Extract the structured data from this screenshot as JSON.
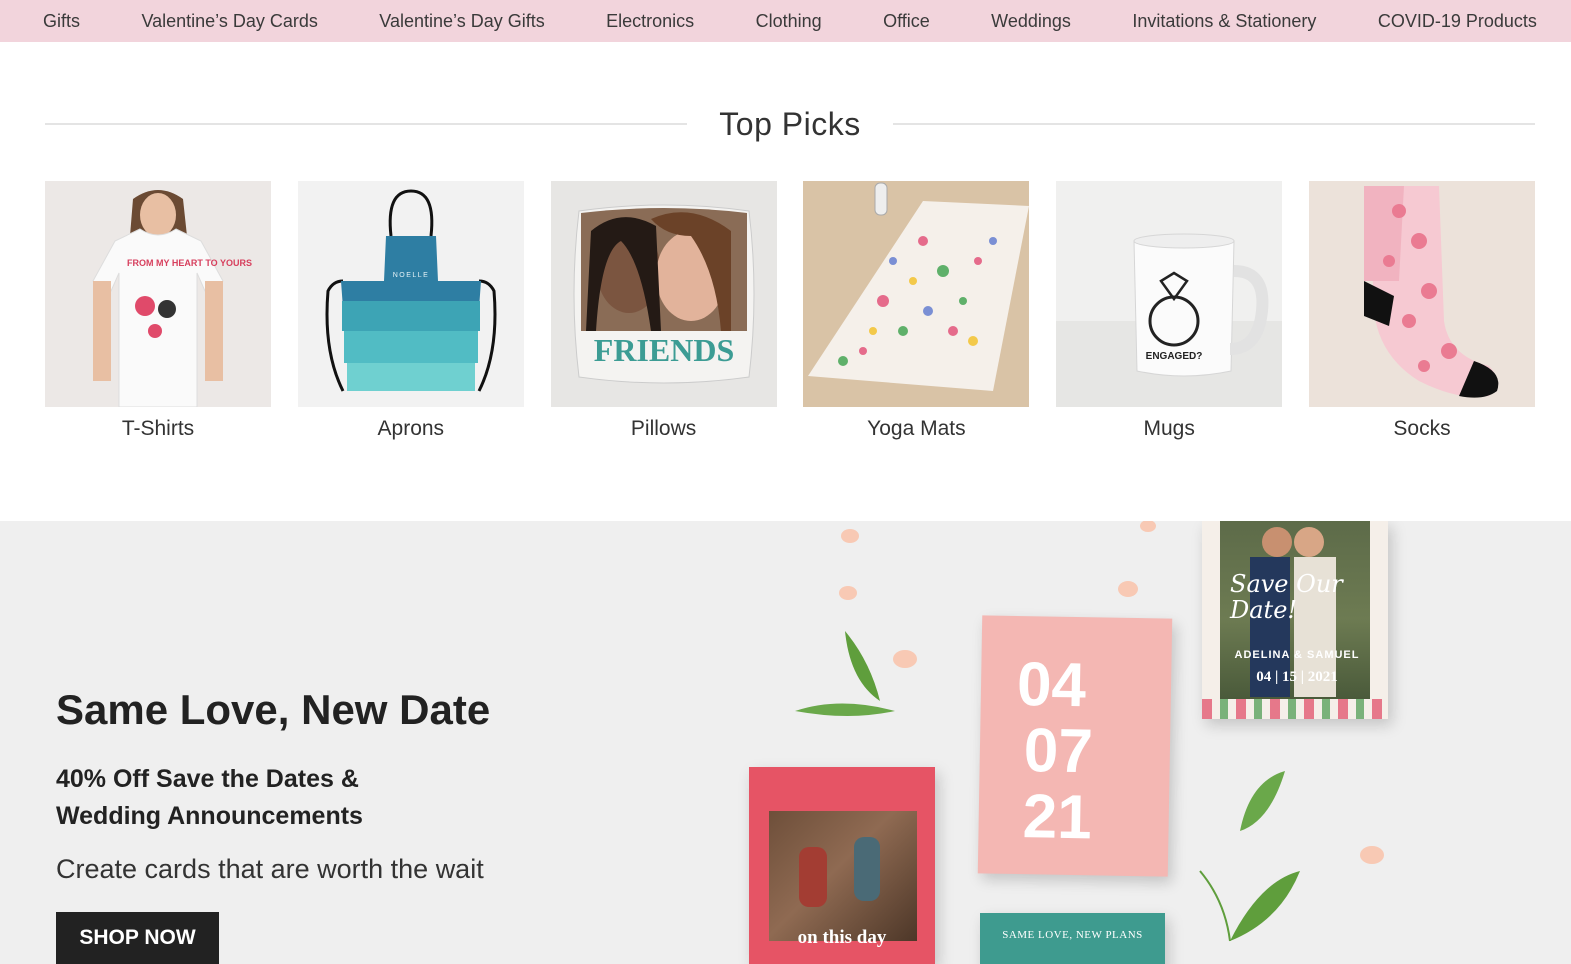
{
  "nav": {
    "items": [
      "Gifts",
      "Valentine’s Day Cards",
      "Valentine’s Day Gifts",
      "Electronics",
      "Clothing",
      "Office",
      "Weddings",
      "Invitations & Stationery",
      "COVID-19 Products"
    ]
  },
  "top_picks": {
    "title": "Top Picks",
    "items": [
      {
        "label": "T-Shirts",
        "image_icon": "tshirt-icon",
        "shirt_text": "FROM MY HEART TO YOURS"
      },
      {
        "label": "Aprons",
        "image_icon": "apron-icon",
        "apron_text": "NOELLE"
      },
      {
        "label": "Pillows",
        "image_icon": "pillow-icon",
        "pillow_text": "FRIENDS"
      },
      {
        "label": "Yoga Mats",
        "image_icon": "yoga-mat-icon"
      },
      {
        "label": "Mugs",
        "image_icon": "mug-icon",
        "mug_text": "ENGAGED?"
      },
      {
        "label": "Socks",
        "image_icon": "socks-icon"
      }
    ]
  },
  "banner": {
    "title": "Same Love, New Date",
    "subtitle": "40% Off Save the Dates & Wedding Announcements",
    "description": "Create cards that are worth the wait",
    "button_label": "SHOP NOW",
    "card_save_date": {
      "script": "Save Our Date!",
      "names": "ADELINA & SAMUEL",
      "date": "04 | 15 | 2021"
    },
    "card_numbers": {
      "d1": "04",
      "d2": "07",
      "d3": "21"
    },
    "card_photo": {
      "caption": "on this day"
    },
    "card_teal": {
      "text": "SAME LOVE, NEW PLANS"
    }
  },
  "colors": {
    "nav_bg": "#f2d4dc",
    "button_bg": "#222222",
    "banner_bg": "#efefef"
  }
}
